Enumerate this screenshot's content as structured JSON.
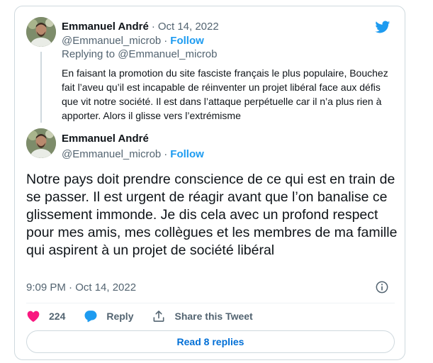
{
  "quoted_tweet": {
    "author_name": "Emmanuel André",
    "separator": "·",
    "date": "Oct 14, 2022",
    "handle": "@Emmanuel_microb",
    "handle_separator": "·",
    "follow_label": "Follow",
    "replying_prefix": "Replying to",
    "replying_to": "@Emmanuel_microb",
    "text": "En faisant la promotion du site fasciste français le plus populaire, Bouchez fait l’aveu qu’il est incapable de réinventer un projet libéral face aux défis que vit notre société. Il est dans l’attaque perpétuelle car il n’a plus rien à apporter. Alors il glisse vers l’extrémisme"
  },
  "main_tweet": {
    "author_name": "Emmanuel André",
    "handle": "@Emmanuel_microb",
    "handle_separator": "·",
    "follow_label": "Follow",
    "text": "Notre pays doit prendre conscience de ce qui est en train de se passer. Il est urgent de réagir avant que l’on banalise ce glissement immonde. Je dis cela avec un profond respect pour mes amis, mes collègues et les membres de ma famille qui aspirent à un projet de société libéral",
    "timestamp": "9:09 PM · Oct 14, 2022"
  },
  "actions": {
    "like_count": "224",
    "reply_label": "Reply",
    "share_label": "Share this Tweet"
  },
  "read_replies_label": "Read 8 replies",
  "icons": {
    "logo": "twitter-bird-icon",
    "like": "heart-icon",
    "reply": "speech-bubble-icon",
    "share": "share-upload-icon",
    "info": "info-icon"
  },
  "colors": {
    "brand": "#1d9bf0",
    "like": "#f91880",
    "text_primary": "#0f1419",
    "text_secondary": "#536471",
    "border": "#cfd9de",
    "link": "#006fd6"
  }
}
